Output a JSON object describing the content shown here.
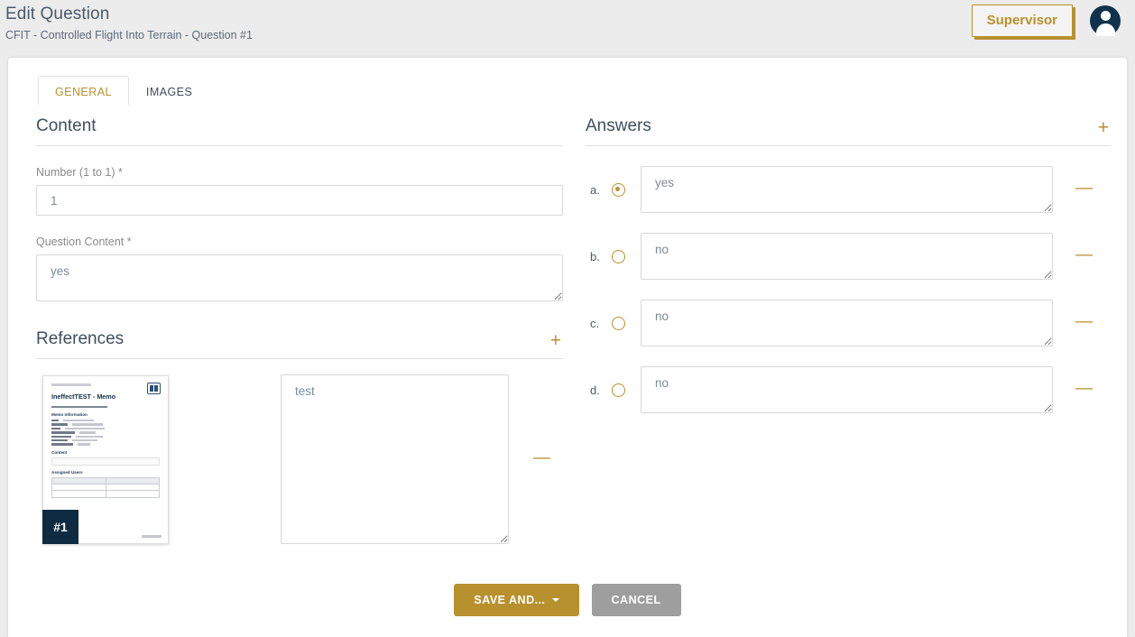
{
  "header": {
    "title": "Edit Question",
    "breadcrumb": "CFIT - Controlled Flight Into Terrain - Question #1",
    "role_button": "Supervisor"
  },
  "tabs": [
    {
      "label": "GENERAL",
      "active": true
    },
    {
      "label": "IMAGES",
      "active": false
    }
  ],
  "content": {
    "section_title": "Content",
    "number_label": "Number (1 to 1) *",
    "number_value": "1",
    "question_label": "Question Content *",
    "question_value": "yes"
  },
  "references": {
    "section_title": "References",
    "add_label": "+",
    "remove_label": "—",
    "items": [
      {
        "badge": "#1",
        "note": "test",
        "document": {
          "title": "IneffectTEST - Memo",
          "sections": [
            "Memo Information",
            "Content",
            "Assigned Users"
          ]
        }
      }
    ]
  },
  "answers": {
    "section_title": "Answers",
    "add_label": "+",
    "remove_label": "—",
    "items": [
      {
        "letter": "a.",
        "value": "yes",
        "selected": true
      },
      {
        "letter": "b.",
        "value": "no",
        "selected": false
      },
      {
        "letter": "c.",
        "value": "no",
        "selected": false
      },
      {
        "letter": "d.",
        "value": "no",
        "selected": false
      }
    ]
  },
  "footer": {
    "save_label": "SAVE AND...",
    "cancel_label": "CANCEL"
  },
  "colors": {
    "accent_gold": "#b8912f",
    "navy": "#0e2b42",
    "cancel_gray": "#9e9e9e",
    "page_bg": "#ececec"
  }
}
